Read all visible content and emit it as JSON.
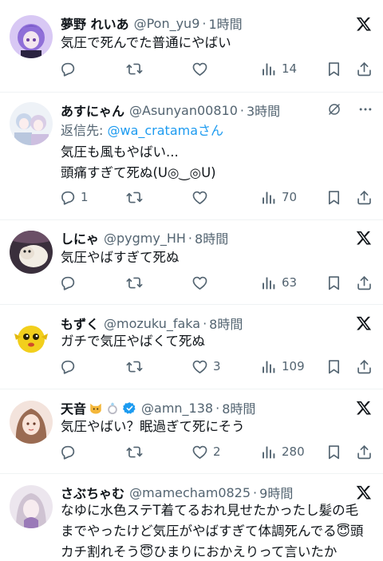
{
  "tweets": [
    {
      "name": "夢野 れいあ",
      "handle": "@Pon_yu9",
      "time": "1時間",
      "text": "気圧で死んでた普通にやばい",
      "reply": "",
      "retweet": "",
      "like": "",
      "views": "14"
    },
    {
      "name": "あすにゃん",
      "handle": "@Asunyan00810",
      "time": "3時間",
      "reply_to_prefix": "返信先: ",
      "reply_to_handle": "@wa_cratama",
      "reply_to_suffix": "さん",
      "text": "気圧も風もやばい...\n頭痛すぎて死ぬ(U◎‿◎U)",
      "reply": "1",
      "retweet": "",
      "like": "",
      "views": "70"
    },
    {
      "name": "しにゃ",
      "handle": "@pygmy_HH",
      "time": "8時間",
      "text": "気圧やばすぎて死ぬ",
      "reply": "",
      "retweet": "",
      "like": "",
      "views": "63"
    },
    {
      "name": "もずく",
      "handle": "@mozuku_faka",
      "time": "8時間",
      "text": "ガチで気圧やばくて死ぬ",
      "reply": "",
      "retweet": "",
      "like": "3",
      "views": "109"
    },
    {
      "name": "天音",
      "handle": "@amn_138",
      "time": "8時間",
      "text": "気圧やばい？眠過ぎて死にそう",
      "reply": "",
      "retweet": "",
      "like": "2",
      "views": "280"
    },
    {
      "name": "さぶちゃむ",
      "handle": "@mamecham0825",
      "time": "9時間",
      "text": "なゆに水色ステT着てるおれ見せたかったし髪の毛までやったけど気圧がやばすぎて体調死んでる😇頭カチ割れそう😇ひまりにおかえりって言いたか"
    }
  ],
  "sep": "·",
  "colors": {
    "text": "#0f1419",
    "secondary": "#536471",
    "link": "#1d9bf0",
    "verified": "#1d9bf0",
    "divider": "#eff3f4"
  },
  "icons": [
    "x-logo-icon",
    "grok-icon",
    "more-icon",
    "reply-icon",
    "retweet-icon",
    "like-icon",
    "views-icon",
    "bookmark-icon",
    "share-icon",
    "verified-badge-icon"
  ]
}
